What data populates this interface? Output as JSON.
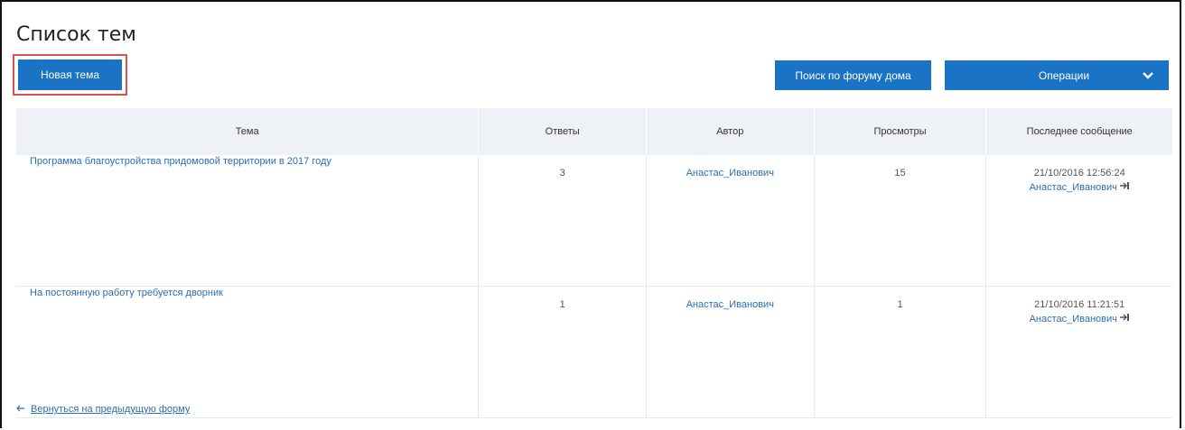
{
  "page": {
    "title": "Список тем"
  },
  "toolbar": {
    "new_topic_label": "Новая тема",
    "forum_search_label": "Поиск по форуму дома",
    "operations_label": "Операции"
  },
  "table": {
    "headers": {
      "topic": "Тема",
      "replies": "Ответы",
      "author": "Автор",
      "views": "Просмотры",
      "last_message": "Последнее сообщение"
    },
    "rows": [
      {
        "topic": "Программа благоустройства придомовой территории в 2017 году",
        "replies": "3",
        "author": "Анастас_Иванович",
        "views": "15",
        "last_date": "21/10/2016 12:56:24",
        "last_author": "Анастас_Иванович"
      },
      {
        "topic": "На постоянную работу требуется дворник",
        "replies": "1",
        "author": "Анастас_Иванович",
        "views": "1",
        "last_date": "21/10/2016 11:21:51",
        "last_author": "Анастас_Иванович"
      }
    ]
  },
  "footer": {
    "back_link": "Вернуться на предыдущую форму"
  },
  "colors": {
    "accent": "#1a73c4",
    "highlight_border": "#e05050",
    "header_bg": "#eef1f6",
    "link": "#2c6db3"
  },
  "icons": [
    "chevron-down-icon",
    "go-to-message-icon",
    "back-arrow-icon"
  ]
}
